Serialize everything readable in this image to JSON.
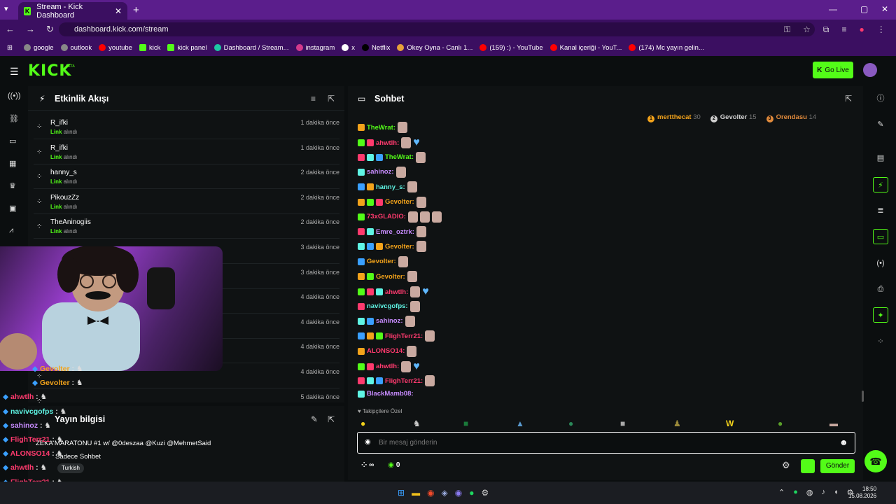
{
  "browser": {
    "tab_title": "Stream - Kick Dashboard",
    "url": "dashboard.kick.com/stream",
    "bookmarks": [
      "google",
      "outlook",
      "youtube",
      "kick",
      "kick panel",
      "Dashboard / Stream...",
      "instagram",
      "x",
      "Netflix",
      "Okey Oyna - Canlı 1...",
      "(159) :) - YouTube",
      "Kanal içeriği - YouT...",
      "(174) Mc yayın gelin..."
    ]
  },
  "header": {
    "logo": "KICK",
    "beta": "BETA",
    "go_live": "Go Live"
  },
  "activity": {
    "title": "Etkinlik Akışı",
    "event_label": "Link",
    "event_suffix": "alındı",
    "rows": [
      {
        "name": "R_ifki",
        "time": "1 dakika önce"
      },
      {
        "name": "R_ifki",
        "time": "1 dakika önce"
      },
      {
        "name": "hanny_s",
        "time": "2 dakika önce"
      },
      {
        "name": "PikouzZz",
        "time": "2 dakika önce"
      },
      {
        "name": "TheAninogiis",
        "time": "2 dakika önce"
      },
      {
        "name": "",
        "time": "3 dakika önce"
      },
      {
        "name": "",
        "time": "3 dakika önce"
      },
      {
        "name": "",
        "time": "4 dakika önce"
      },
      {
        "name": "",
        "time": "4 dakika önce"
      },
      {
        "name": "",
        "time": "4 dakika önce"
      },
      {
        "name": "",
        "time": "4 dakika önce"
      },
      {
        "name": "",
        "time": "5 dakika önce"
      }
    ]
  },
  "stream_info": {
    "title": "Yayın bilgisi",
    "stream_title": "ZEKA MARATONU #1 w/ @0deszaa @Kuzi @MehmetSaid",
    "chat_mode": "Sadece Sohbet",
    "tag": "Turkish"
  },
  "overlay_chat": [
    {
      "name": "Gevolter",
      "color": "#f3a31b"
    },
    {
      "name": "Gevolter",
      "color": "#f3a31b"
    },
    {
      "name": "ahwtlh",
      "color": "#ff3a6e"
    },
    {
      "name": "navivcgofps",
      "color": "#5ff5e5"
    },
    {
      "name": "sahinoz",
      "color": "#c88cff"
    },
    {
      "name": "FlighTerr21",
      "color": "#ff3a6e"
    },
    {
      "name": "ALONSO14",
      "color": "#ff3a6e"
    },
    {
      "name": "ahwtlh",
      "color": "#ff3a6e"
    },
    {
      "name": "FlighTerr21",
      "color": "#ff3a6e"
    },
    {
      "name": "BlackMamb08",
      "color": "#8e8eb0"
    }
  ],
  "chat": {
    "title": "Sohbet",
    "leaderboard": [
      {
        "rank": "1",
        "name": "mertthecat",
        "count": "30",
        "color": "#f3a31b"
      },
      {
        "rank": "2",
        "name": "Gevolter",
        "count": "15",
        "color": "#d0d0d0"
      },
      {
        "rank": "3",
        "name": "Orendasu",
        "count": "14",
        "color": "#e08a3c"
      }
    ],
    "messages": [
      {
        "name": "TheWrat:",
        "color": "#53fc18",
        "heart": false,
        "emotes": 1
      },
      {
        "name": "ahwtlh:",
        "color": "#ff3a6e",
        "heart": true,
        "emotes": 1
      },
      {
        "name": "TheWrat:",
        "color": "#53fc18",
        "heart": false,
        "emotes": 1
      },
      {
        "name": "sahinoz:",
        "color": "#c88cff",
        "heart": false,
        "emotes": 1
      },
      {
        "name": "hanny_s:",
        "color": "#5ff5e5",
        "heart": false,
        "emotes": 1
      },
      {
        "name": "Gevolter:",
        "color": "#f3a31b",
        "heart": false,
        "emotes": 1
      },
      {
        "name": "73xGLADIO:",
        "color": "#ff3a6e",
        "heart": false,
        "emotes": 3
      },
      {
        "name": "Emre_oztrk:",
        "color": "#c88cff",
        "heart": false,
        "emotes": 1
      },
      {
        "name": "Gevolter:",
        "color": "#f3a31b",
        "heart": false,
        "emotes": 1
      },
      {
        "name": "Gevolter:",
        "color": "#f3a31b",
        "heart": false,
        "emotes": 1
      },
      {
        "name": "Gevolter:",
        "color": "#f3a31b",
        "heart": false,
        "emotes": 1
      },
      {
        "name": "ahwtlh:",
        "color": "#ff3a6e",
        "heart": true,
        "emotes": 1
      },
      {
        "name": "navivcgofps:",
        "color": "#5ff5e5",
        "heart": false,
        "emotes": 1
      },
      {
        "name": "sahinoz:",
        "color": "#c88cff",
        "heart": false,
        "emotes": 1
      },
      {
        "name": "FlighTerr21:",
        "color": "#ff3a6e",
        "heart": false,
        "emotes": 1
      },
      {
        "name": "ALONSO14:",
        "color": "#ff3a6e",
        "heart": false,
        "emotes": 1
      },
      {
        "name": "ahwtlh:",
        "color": "#ff3a6e",
        "heart": true,
        "emotes": 1
      },
      {
        "name": "FlighTerr21:",
        "color": "#ff3a6e",
        "heart": false,
        "emotes": 1
      },
      {
        "name": "BlackMamb08:",
        "color": "#c88cff",
        "heart": false,
        "emotes": 0
      }
    ],
    "followers_only": "Takipçilere Özel",
    "input_placeholder": "Bir mesaj gönderin",
    "send": "Gönder",
    "points": "0"
  },
  "taskbar": {
    "time": "18:50",
    "date": "15.08.2026"
  },
  "colors": {
    "accent": "#53fc18",
    "bg": "#0b0e0f",
    "panel": "#0f1213",
    "chrome": "#3b0f61"
  }
}
